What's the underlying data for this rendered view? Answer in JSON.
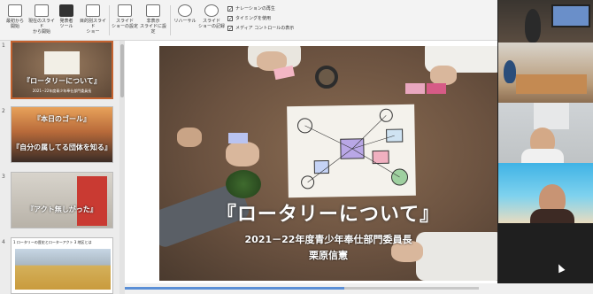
{
  "ribbon": {
    "buttons": [
      {
        "label": "最初から\n開始",
        "icon": "play-icon"
      },
      {
        "label": "現在のスライド\nから開始",
        "icon": "slide-play-icon"
      },
      {
        "label": "発表者\nツール",
        "icon": "presenter-icon"
      },
      {
        "label": "目的別スライド\nショー",
        "icon": "custom-show-icon"
      },
      {
        "label": "スライド\nショーの設定",
        "icon": "setup-icon"
      },
      {
        "label": "非表示\nスライドに設定",
        "icon": "hide-slide-icon"
      },
      {
        "label": "リハーサル",
        "icon": "timer-icon"
      },
      {
        "label": "スライド\nショーの記録",
        "icon": "record-icon"
      }
    ],
    "checkboxes": [
      {
        "label": "ナレーションの再生",
        "checked": true
      },
      {
        "label": "タイミングを使用",
        "checked": true
      },
      {
        "label": "メディア コントロールの表示",
        "checked": true
      }
    ]
  },
  "thumbnails": [
    {
      "number": "1",
      "title": "『ロータリーについて』",
      "subtitle": "2021−22年度青少年奉仕部門委員長",
      "selected": true
    },
    {
      "number": "2",
      "title": "『本日のゴール』",
      "subtitle": "『自分の属してる団体を知る』",
      "selected": false
    },
    {
      "number": "3",
      "title": "『アクト無しがった』",
      "subtitle": "",
      "selected": false
    },
    {
      "number": "4",
      "title": "1 ロータリーの歴史とローターアクト 3 地区とは",
      "subtitle": "",
      "selected": false
    }
  ],
  "slide": {
    "title": "『ロータリーについて』",
    "subtitle": "2021－22年度青少年奉仕部門委員長",
    "presenter": "栗原信憲"
  },
  "sticky_notes": [
    "",
    "",
    "",
    ""
  ],
  "progress": {
    "fraction": 0.62
  },
  "video_tiles": [
    {
      "name": "participant-1"
    },
    {
      "name": "participant-2"
    },
    {
      "name": "participant-3"
    },
    {
      "name": "participant-4"
    },
    {
      "name": "participant-5"
    }
  ],
  "colors": {
    "accent": "#c4622f",
    "ribbon": "#f3f3f3"
  }
}
